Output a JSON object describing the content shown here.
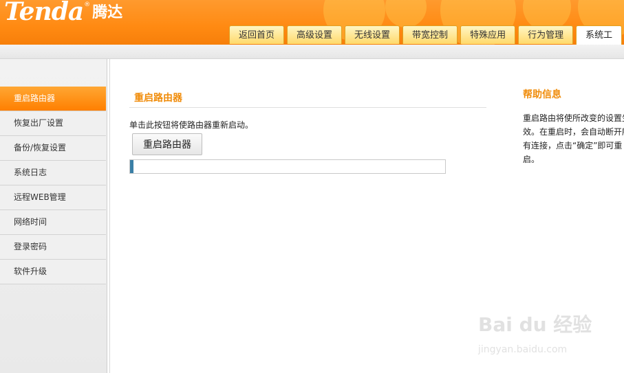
{
  "header": {
    "logo_en": "Tenda",
    "logo_reg": "®",
    "logo_cn": "腾达",
    "tabs": [
      {
        "label": "返回首页"
      },
      {
        "label": "高级设置"
      },
      {
        "label": "无线设置"
      },
      {
        "label": "带宽控制"
      },
      {
        "label": "特殊应用"
      },
      {
        "label": "行为管理"
      },
      {
        "label": "系统工"
      }
    ],
    "active_tab": "系统工"
  },
  "sidebar": {
    "items": [
      {
        "label": "重启路由器"
      },
      {
        "label": "恢复出厂设置"
      },
      {
        "label": "备份/恢复设置"
      },
      {
        "label": "系统日志"
      },
      {
        "label": "远程WEB管理"
      },
      {
        "label": "网络时间"
      },
      {
        "label": "登录密码"
      },
      {
        "label": "软件升级"
      }
    ],
    "active_item": "重启路由器"
  },
  "main": {
    "title": "重启路由器",
    "description": "单击此按钮将使路由器重新启动。",
    "button_label": "重启路由器",
    "progress_percent": 1
  },
  "help": {
    "title": "帮助信息",
    "lines": [
      "重启路由将使所改变的设置生",
      "效。在重启时，会自动断开所",
      "有连接，点击“确定”即可重",
      "启。"
    ]
  },
  "watermark": {
    "main": "Bai du 经验",
    "sub": "jingyan.baidu.com"
  },
  "colors": {
    "header_orange": "#ff8a12",
    "accent_orange": "#f08c0a",
    "progress_blue": "#3a7fa6"
  }
}
